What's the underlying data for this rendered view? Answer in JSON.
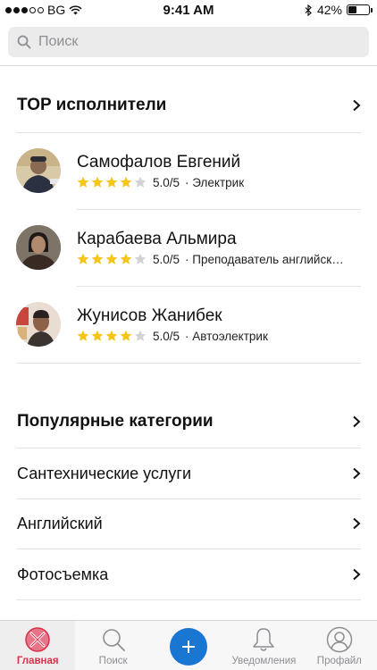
{
  "status_bar": {
    "carrier": "BG",
    "time": "9:41 AM",
    "battery": "42%",
    "battery_level": 0.42
  },
  "search": {
    "placeholder": "Поиск"
  },
  "top_section": {
    "title": "TOP исполнители",
    "performers": [
      {
        "name": "Самофалов Евгений",
        "rating": "5.0/5",
        "profession": "· Электрик",
        "stars": 4
      },
      {
        "name": "Карабаева Альмира",
        "rating": "5.0/5",
        "profession": "· Преподаватель английского",
        "stars": 4
      },
      {
        "name": "Жунисов Жанибек",
        "rating": "5.0/5",
        "profession": "· Автоэлектрик",
        "stars": 4
      }
    ]
  },
  "categories_section": {
    "title": "Популярные категории",
    "items": [
      "Сантехнические услуги",
      "Английский",
      "Фотосъемка"
    ]
  },
  "tabbar": {
    "tabs": [
      {
        "label": "Главная",
        "icon": "home-x-icon"
      },
      {
        "label": "Поиск",
        "icon": "search-icon"
      },
      {
        "label": "",
        "icon": "plus-icon"
      },
      {
        "label": "Уведомления",
        "icon": "bell-icon"
      },
      {
        "label": "Профайл",
        "icon": "user-icon"
      }
    ]
  },
  "colors": {
    "accent": "#d9324b",
    "primary": "#1976d2",
    "star": "#f5c518"
  }
}
